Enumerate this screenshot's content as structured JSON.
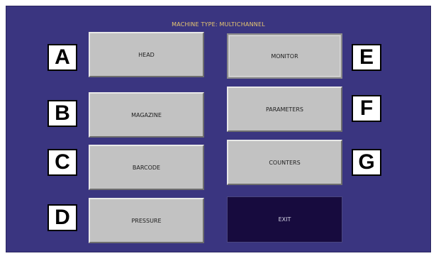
{
  "header": {
    "title": "MACHINE TYPE: MULTICHANNEL"
  },
  "buttons": {
    "head": "HEAD",
    "magazine": "MAGAZINE",
    "barcode": "BARCODE",
    "pressure": "PRESSURE",
    "monitor": "MONITOR",
    "parameters": "PARAMETERS",
    "counters": "COUNTERS",
    "exit": "EXIT"
  },
  "callouts": {
    "a": "A",
    "b": "B",
    "c": "C",
    "d": "D",
    "e": "E",
    "f": "F",
    "g": "G"
  },
  "colors": {
    "background": "#3a3580",
    "title_text": "#e8c870",
    "button": "#c2c2c2",
    "exit_button": "#170b3e"
  }
}
